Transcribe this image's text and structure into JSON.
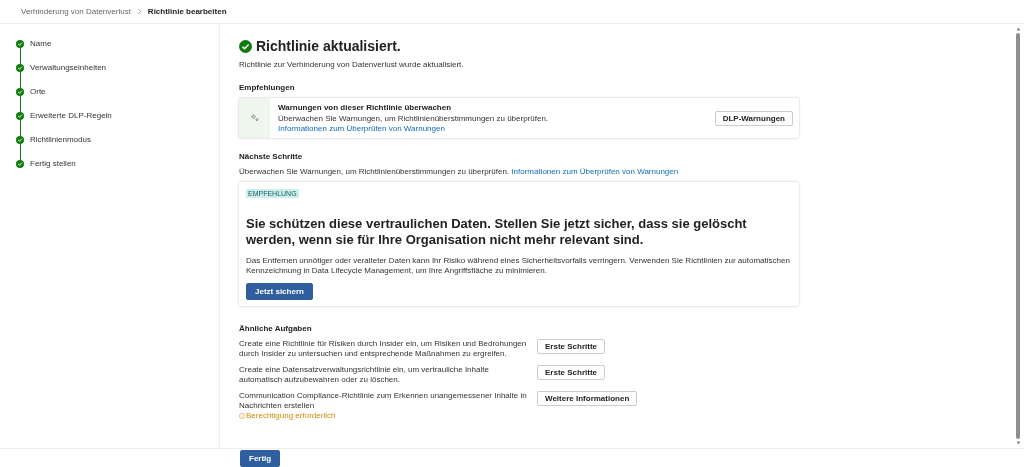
{
  "breadcrumb": [
    {
      "label": "Verhinderung von Datenverlust",
      "current": false
    },
    {
      "label": "Richtlinie bearbeiten",
      "current": true
    }
  ],
  "steps": [
    {
      "label": "Name",
      "completed": true
    },
    {
      "label": "Verwaltungseinheiten",
      "completed": true
    },
    {
      "label": "Orte",
      "completed": true
    },
    {
      "label": "Erweiterte DLP-Regeln",
      "completed": true
    },
    {
      "label": "Richtlinienmodus",
      "completed": true
    },
    {
      "label": "Fertig stellen",
      "completed": true
    }
  ],
  "title": "Richtlinie aktualisiert.",
  "subtitle": "Richtlinie zur Verhinderung von Datenverlust wurde aktualisiert.",
  "recommendations": {
    "heading": "Empfehlungen",
    "card": {
      "title": "Warnungen von dieser Richtlinie überwachen",
      "text": "Überwachen Sie Warnungen, um Richtlinienüberstimmungen zu überprüfen.",
      "link": "Informationen zum Überprüfen von Warnungen",
      "button": "DLP-Warnungen"
    }
  },
  "next_steps": {
    "heading": "Nächste Schritte",
    "text": "Überwachen Sie Warnungen, um Richtlinienüberstimmungen zu überprüfen.",
    "link": "Informationen zum Überprüfen von Warnungen"
  },
  "promo": {
    "tag": "EMPFEHLUNG",
    "headline": "Sie schützen diese vertraulichen Daten. Stellen Sie jetzt sicher, dass sie gelöscht werden, wenn sie für Ihre Organisation nicht mehr relevant sind.",
    "text": "Das Entfernen unnötiger oder veralteter Daten kann Ihr Risiko während eines Sicherheitsvorfalls verringern. Verwenden Sie Richtlinien zur automatischen Kennzeichnung in Data Lifecycle Management, um Ihre Angriffsfläche zu minimieren.",
    "button": "Jetzt sichern"
  },
  "related": {
    "heading": "Ähnliche Aufgaben",
    "tasks": [
      {
        "text": "Create eine Richtlinie für Risiken durch Insider ein, um Risiken und Bedrohungen durch Insider zu untersuchen und entsprechende Maßnahmen zu ergreifen.",
        "button": "Erste Schritte"
      },
      {
        "text": "Create eine Datensatzverwaltungsrichtlinie ein, um vertrauliche Inhalte automatisch aufzubewahren oder zu löschen.",
        "button": "Erste Schritte"
      },
      {
        "text": "Communication Compliance-Richtlinie zum Erkennen unangemessener Inhalte in Nachrichten erstellen",
        "button": "Weitere Informationen",
        "warning": "Berechtigung erforderlich"
      }
    ]
  },
  "footer": {
    "button": "Fertig"
  }
}
